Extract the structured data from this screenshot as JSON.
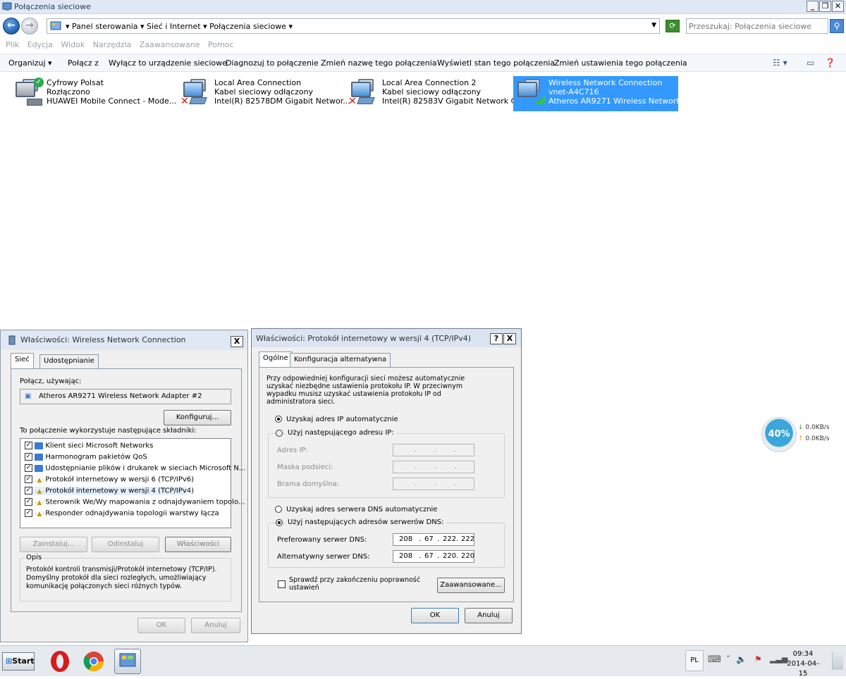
{
  "window": {
    "title": "Połączenia sieciowe",
    "controls": {
      "minimize": "_",
      "maximize": "❐",
      "close": "✕"
    }
  },
  "address": {
    "crumbs": "▾  Panel sterowania  ▾  Sieć i Internet  ▾  Połączenia sieciowe  ▾",
    "search_placeholder": "Przeszukaj: Połączenia sieciowe"
  },
  "menu": [
    "Plik",
    "Edycja",
    "Widok",
    "Narzędzia",
    "Zaawansowane",
    "Pomoc"
  ],
  "toolbar": {
    "organize": "Organizuj ▾",
    "connect": "Połącz z",
    "disable": "Wyłącz to urządzenie sieciowe",
    "diagnose": "Diagnozuj to połączenie",
    "rename": "Zmień nazwę tego połączenia",
    "status": "Wyświetl stan tego połączenia",
    "settings": "Zmień ustawienia tego połączenia"
  },
  "connections": [
    {
      "name": "Cyfrowy Polsat",
      "status": "Rozłączono",
      "device": "HUAWEI Mobile Connect - Mode..."
    },
    {
      "name": "Local Area Connection",
      "status": "Kabel sieciowy odłączony",
      "device": "Intel(R) 82578DM Gigabit Networ..."
    },
    {
      "name": "Local Area Connection 2",
      "status": "Kabel sieciowy odłączony",
      "device": "Intel(R) 82583V Gigabit Network C..."
    },
    {
      "name": "Wireless Network Connection",
      "status": "vnet-A4C716",
      "device": "Atheros AR9271 Wireless Network..."
    }
  ],
  "props_dialog": {
    "title": "Właściwości: Wireless Network Connection",
    "tabs": [
      "Sieć",
      "Udostępnianie"
    ],
    "connect_using_label": "Połącz, używając:",
    "adapter": "Atheros AR9271 Wireless Network Adapter #2",
    "configure": "Konfiguruj...",
    "components_label": "To połączenie wykorzystuje następujące składniki:",
    "components": [
      "Klient sieci Microsoft Networks",
      "Harmonogram pakietów QoS",
      "Udostępnianie plików i drukarek w sieciach Microsoft N...",
      "Protokół internetowy w wersji 6 (TCP/IPv6)",
      "Protokół internetowy w wersji 4 (TCP/IPv4)",
      "Sterownik We/Wy mapowania z odnajdywaniem topolo...",
      "Responder odnajdywania topologii warstwy łącza"
    ],
    "install": "Zainstaluj...",
    "uninstall": "Odinstaluj",
    "properties": "Właściwości",
    "desc_title": "Opis",
    "description": "Protokół kontroli transmisji/Protokół internetowy (TCP/IP). Domyślny protokół dla sieci rozległych, umożliwiający komunikację połączonych sieci różnych typów.",
    "ok": "OK",
    "cancel": "Anuluj"
  },
  "ipv4_dialog": {
    "title": "Właściwości: Protokół internetowy w wersji 4 (TCP/IPv4)",
    "help": "?",
    "tabs": [
      "Ogólne",
      "Konfiguracja alternatywna"
    ],
    "intro": "Przy odpowiedniej konfiguracji sieci możesz automatycznie uzyskać niezbędne ustawienia protokołu IP. W przeciwnym wypadku musisz uzyskać ustawienia protokołu IP od administratora sieci.",
    "auto_ip": "Uzyskaj adres IP automatycznie",
    "manual_ip": "Użyj następującego adresu IP:",
    "ip_label": "Adres IP:",
    "mask_label": "Maska podsieci:",
    "gateway_label": "Brama domyślna:",
    "auto_dns": "Uzyskaj adres serwera DNS automatycznie",
    "manual_dns": "Użyj następujących adresów serwerów DNS:",
    "pref_dns_label": "Preferowany serwer DNS:",
    "alt_dns_label": "Alternatywny serwer DNS:",
    "pref_dns": [
      "208",
      "67",
      "222",
      "222"
    ],
    "alt_dns": [
      "208",
      "67",
      "220",
      "220"
    ],
    "validate": "Sprawdź przy zakończeniu poprawność ustawień",
    "advanced": "Zaawansowane...",
    "ok": "OK",
    "cancel": "Anuluj"
  },
  "net_widget": {
    "percent": "40%",
    "down": "0.0KB/s",
    "up": "0.0KB/s"
  },
  "taskbar": {
    "start": "Start",
    "lang": "PL",
    "time": "09:34",
    "date": "2014-04-15"
  }
}
